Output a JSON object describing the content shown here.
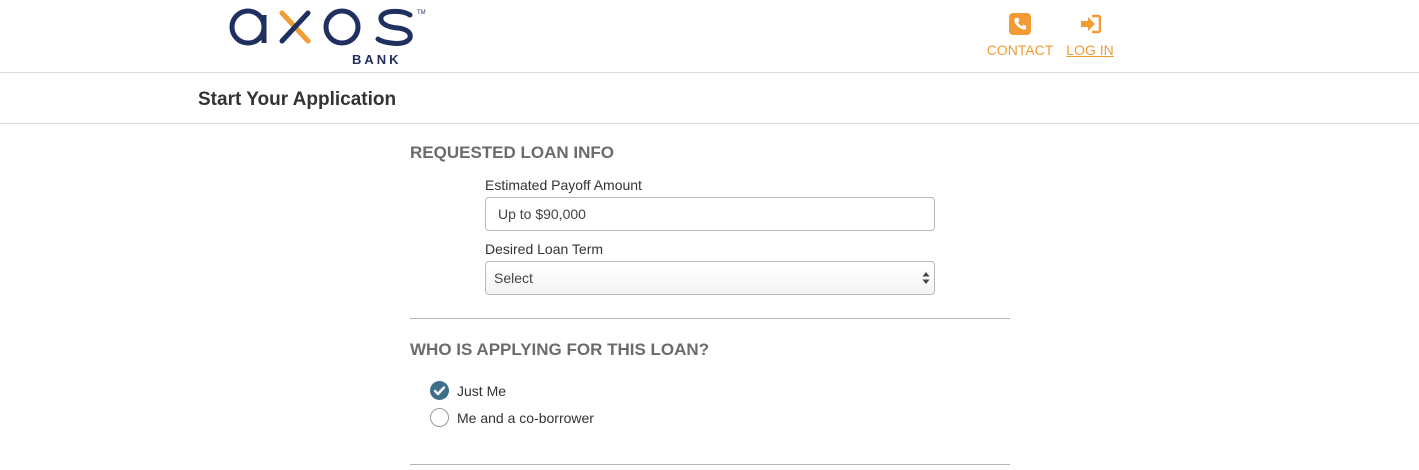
{
  "brand": {
    "logo_word": "axos",
    "logo_sub": "BANK",
    "colors": {
      "navy": "#1f2f5f",
      "orange": "#f39b35",
      "teal": "#3d6f8c"
    }
  },
  "nav": {
    "contact": {
      "label": "CONTACT",
      "icon": "phone-icon"
    },
    "login": {
      "label": "LOG IN",
      "icon": "sign-in-icon"
    }
  },
  "page": {
    "title": "Start Your Application"
  },
  "loan_info": {
    "heading": "REQUESTED LOAN INFO",
    "payoff": {
      "label": "Estimated Payoff Amount",
      "placeholder": "Up to $90,000"
    },
    "term": {
      "label": "Desired Loan Term",
      "selected": "Select"
    }
  },
  "applicants": {
    "heading": "WHO IS APPLYING FOR THIS LOAN?",
    "options": [
      {
        "label": "Just Me",
        "checked": true
      },
      {
        "label": "Me and a co-borrower",
        "checked": false
      }
    ]
  }
}
